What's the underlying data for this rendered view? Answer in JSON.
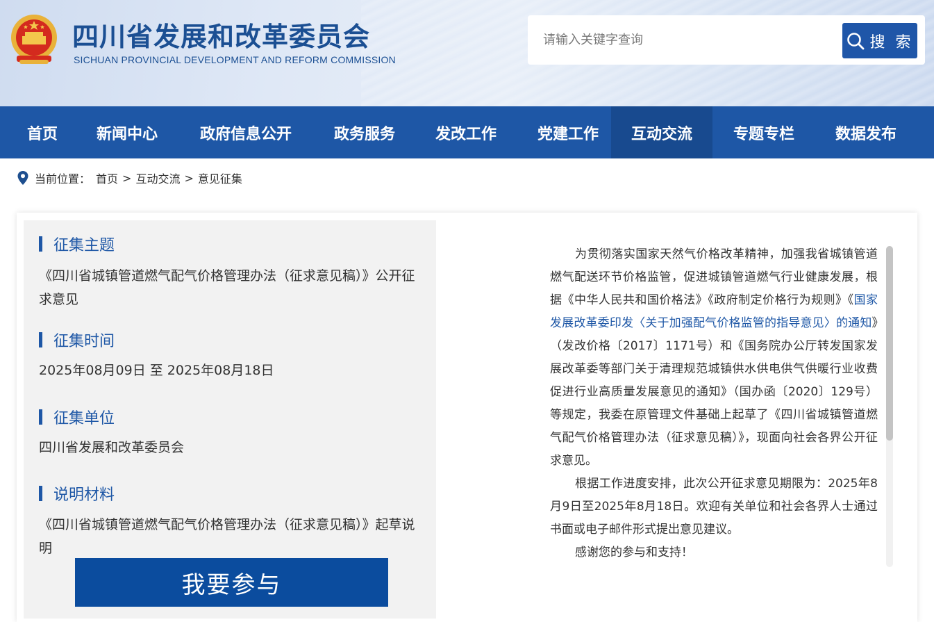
{
  "header": {
    "title": "四川省发展和改革委员会",
    "subtitle": "SICHUAN PROVINCIAL DEVELOPMENT AND REFORM COMMISSION",
    "emblem_icon": "national-emblem-icon"
  },
  "search": {
    "placeholder": "请输入关键字查询",
    "button_label": "搜 索",
    "icon": "search-icon"
  },
  "nav": {
    "items": [
      {
        "label": "首页"
      },
      {
        "label": "新闻中心"
      },
      {
        "label": "政府信息公开"
      },
      {
        "label": "政务服务"
      },
      {
        "label": "发改工作"
      },
      {
        "label": "党建工作"
      },
      {
        "label": "互动交流",
        "active": true
      },
      {
        "label": "专题专栏"
      },
      {
        "label": "数据发布"
      }
    ],
    "active_color": "#184a8f",
    "bg_color": "#1e57a6"
  },
  "breadcrumb": {
    "icon": "location-pin-icon",
    "prefix": "当前位置：",
    "items": [
      "首页",
      "互动交流",
      "意见征集"
    ],
    "separator": ">"
  },
  "left": {
    "topic_heading": "征集主题",
    "topic": "《四川省城镇管道燃气配气价格管理办法（征求意见稿）》公开征求意见",
    "time_heading": "征集时间",
    "time": "2025年08月09日 至 2025年08月18日",
    "unit_heading": "征集单位",
    "unit": "四川省发展和改革委员会",
    "material_heading": "说明材料",
    "material": "《四川省城镇管道燃气配气价格管理办法（征求意见稿）》起草说明",
    "join_button": "我要参与"
  },
  "right": {
    "p1_a": "为贯彻落实国家天然气价格改革精神，加强我省城镇管道燃气配送环节价格监管，促进城镇管道燃气行业健康发展，根据《中华人民共和国价格法》《政府制定价格行为规则》《",
    "p1_link": "国家发展改革委印发〈关于加强配气价格监管的指导意见〉的通知",
    "p1_b": "》（发改价格〔2017〕1171号）和《国务院办公厅转发国家发展改革委等部门关于清理规范城镇供水供电供气供暖行业收费促进行业高质量发展意见的通知》（国办函〔2020〕129号）等规定，我委在原管理文件基础上起草了《四川省城镇管道燃气配气价格管理办法（征求意见稿）》，现面向社会各界公开征求意见。",
    "p2": "根据工作进度安排，此次公开征求意见期限为：2025年8月9日至2025年8月18日。欢迎有关单位和社会各界人士通过书面或电子邮件形式提出意见建议。",
    "p3": "感谢您的参与和支持！"
  }
}
